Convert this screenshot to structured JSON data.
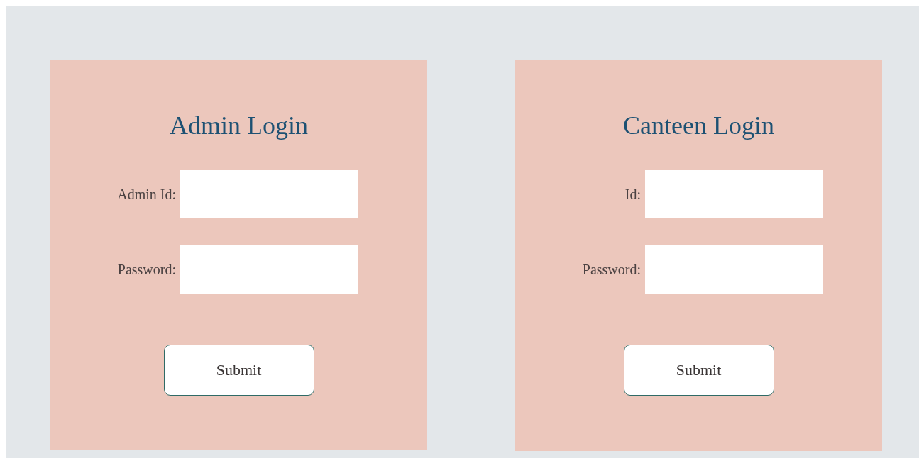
{
  "forms": [
    {
      "title": "Admin Login",
      "fields": [
        {
          "label": "Admin Id:"
        },
        {
          "label": "Password:"
        }
      ],
      "button": "Submit"
    },
    {
      "title": "Canteen Login",
      "fields": [
        {
          "label": "Id:"
        },
        {
          "label": "Password:"
        }
      ],
      "button": "Submit"
    }
  ]
}
